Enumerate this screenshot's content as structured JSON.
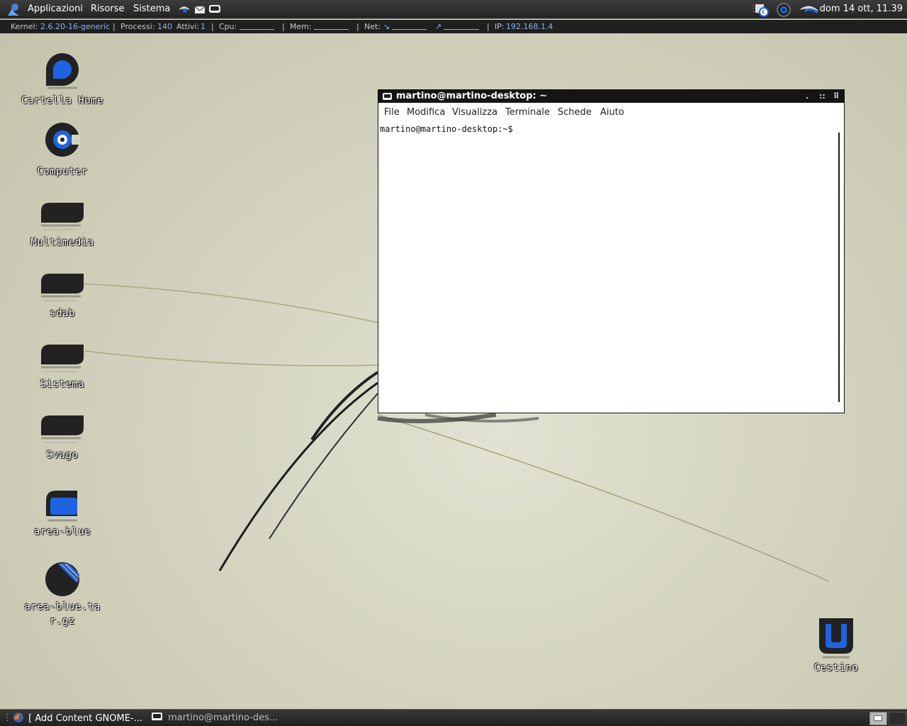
{
  "top_panel": {
    "menus": [
      "Applicazioni",
      "Risorse",
      "Sistema"
    ],
    "clock": "dom 14 ott, 11.39"
  },
  "info_bar": {
    "kernel_label": "Kernel:",
    "kernel_value": "2.6.20-16-generic",
    "processes_label": "Processi:",
    "processes_value": "140",
    "active_label": "Attivi:",
    "active_value": "1",
    "cpu_label": "Cpu:",
    "mem_label": "Mem:",
    "net_label": "Net:",
    "net_down_arrow": "↘",
    "net_up_arrow": "↗",
    "ip_label": "IP:",
    "ip_value": "192.168.1.4",
    "separator": "|"
  },
  "desktop_icons": [
    {
      "label": "Cartella Home",
      "icon": "home-folder-icon"
    },
    {
      "label": "Computer",
      "icon": "computer-icon"
    },
    {
      "label": "Multimedia",
      "icon": "folder-icon"
    },
    {
      "label": "sdab",
      "icon": "folder-icon"
    },
    {
      "label": "Sistema",
      "icon": "folder-icon"
    },
    {
      "label": "Svago",
      "icon": "folder-icon"
    },
    {
      "label": "area-blue",
      "icon": "folder-blue-icon"
    },
    {
      "label": "area-blue.tar.gz",
      "icon": "archive-icon"
    },
    {
      "label": "Cestino",
      "icon": "trash-icon"
    }
  ],
  "terminal": {
    "title": "martino@martino-desktop: ~",
    "menu": [
      "File",
      "Modifica",
      "Visualizza",
      "Terminale",
      "Schede",
      "Aiuto"
    ],
    "prompt": "martino@martino-desktop:~$",
    "buttons": {
      "minimize": ".",
      "maximize": "::",
      "close": "⠿"
    }
  },
  "taskbar": {
    "tasks": [
      {
        "label": "[ Add Content GNOME-...",
        "icon": "firefox-icon",
        "active": false
      },
      {
        "label": "martino@martino-des...",
        "icon": "terminal-icon",
        "active": true
      }
    ]
  },
  "colors": {
    "panel": "#2b2b2b",
    "accent_blue": "#1e64e0",
    "info_value": "#8fb0ec",
    "wallpaper": "#d3d3c0"
  }
}
